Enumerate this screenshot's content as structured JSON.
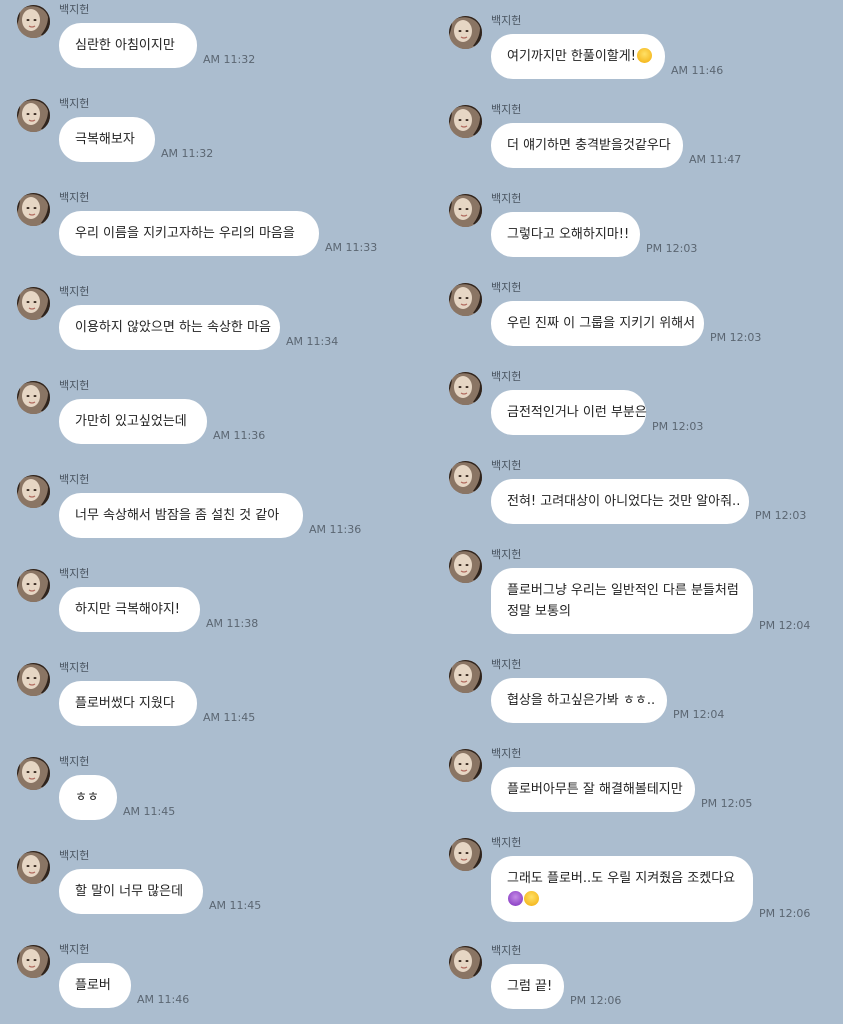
{
  "sender_name": "백지헌",
  "left_messages": [
    {
      "text": "심란한 아침이지만",
      "time": "AM 11:32"
    },
    {
      "text": "극복해보자",
      "time": "AM 11:32"
    },
    {
      "text": "우리 이름을 지키고자하는 우리의 마음을",
      "time": "AM 11:33"
    },
    {
      "text": "이용하지 않았으면 하는 속상한 마음",
      "time": "AM 11:34"
    },
    {
      "text": "가만히 있고싶었는데",
      "time": "AM 11:36"
    },
    {
      "text": "너무 속상해서 밤잠을 좀 설친 것 같아",
      "time": "AM 11:36"
    },
    {
      "text": "하지만 극복해야지!",
      "time": "AM 11:38"
    },
    {
      "text": "플로버썼다 지웠다",
      "time": "AM 11:45"
    },
    {
      "text": "ㅎㅎ",
      "time": "AM 11:45"
    },
    {
      "text": "할 말이 너무 많은데",
      "time": "AM 11:45"
    },
    {
      "text": "플로버",
      "time": "AM 11:46"
    }
  ],
  "right_messages": [
    {
      "text": "여기까지만 한풀이할게!",
      "emoji_after": "smile",
      "time": "AM 11:46"
    },
    {
      "text": "더 얘기하면 충격받을것같우다",
      "time": "AM 11:47"
    },
    {
      "text": "그렇다고 오해하지마!!",
      "time": "PM 12:03"
    },
    {
      "text": "우린 진짜 이 그룹을 지키기 위해서",
      "time": "PM 12:03"
    },
    {
      "text": "금전적인거나 이런 부분은",
      "time": "PM 12:03"
    },
    {
      "text": "전혀! 고려대상이 아니었다는 것만 알아줘..",
      "time": "PM 12:03"
    },
    {
      "text": "플로버그냥 우리는 일반적인 다른 분들처럼",
      "line2": "정말 보통의",
      "time": "PM 12:04"
    },
    {
      "text": "협상을 하고싶은가봐 ㅎㅎ..",
      "time": "PM 12:04"
    },
    {
      "text": "플로버아무튼 잘 해결해볼테지만",
      "time": "PM 12:05"
    },
    {
      "text": "그래도 플로버..도 우릴 지켜줬음 조켔다요",
      "line2_emojis": [
        "devil",
        "smile"
      ],
      "time": "PM 12:06"
    },
    {
      "text": "그럼 끝!",
      "time": "PM 12:06"
    }
  ],
  "colors": {
    "background": "#abbdcf",
    "bubble": "#ffffff",
    "text": "#222222",
    "time": "#5b6672",
    "sender": "#4a5561"
  }
}
